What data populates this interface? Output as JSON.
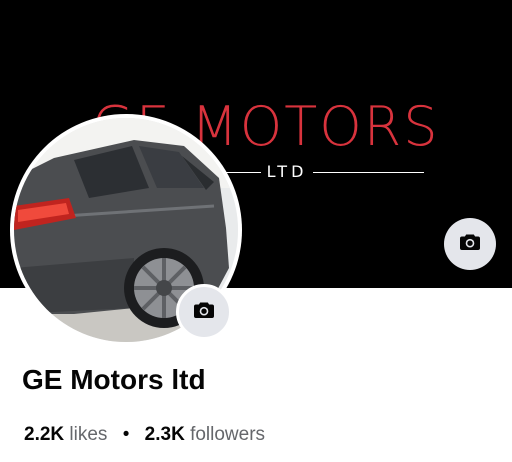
{
  "cover": {
    "brand": "GE MOTORS",
    "subtitle": "LTD",
    "brand_color": "#d8333d",
    "background": "#000000"
  },
  "profile": {
    "name": "GE Motors ltd",
    "likes_count": "2.2K",
    "likes_label": "likes",
    "separator": "•",
    "followers_count": "2.3K",
    "followers_label": "followers"
  },
  "icons": {
    "cover_camera": "camera-icon",
    "avatar_camera": "camera-icon"
  }
}
